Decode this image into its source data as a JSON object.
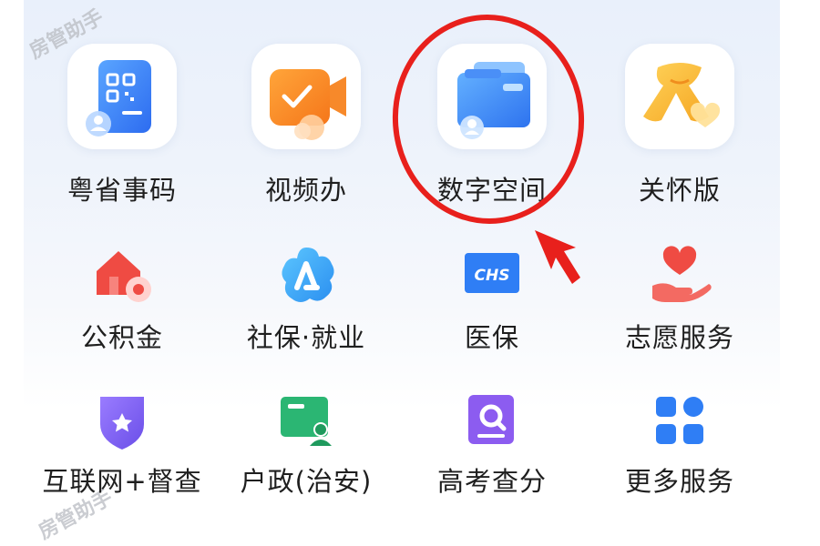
{
  "watermark": "房管助手",
  "colors": {
    "highlight_red": "#e8201c",
    "primary_blue": "#2f7ef5",
    "orange": "#f7891f",
    "yellow": "#f7b733",
    "green": "#2bb673",
    "purple": "#7b5cf0",
    "red_icon": "#ef4b43"
  },
  "services": {
    "row1": [
      {
        "label": "粤省事码",
        "icon": "qr-card-icon"
      },
      {
        "label": "视频办",
        "icon": "video-check-icon"
      },
      {
        "label": "数字空间",
        "icon": "wallet-user-icon",
        "highlighted": true
      },
      {
        "label": "关怀版",
        "icon": "scarf-heart-icon"
      }
    ],
    "row2": [
      {
        "label": "公积金",
        "icon": "house-coin-icon"
      },
      {
        "label": "社保·就业",
        "icon": "social-security-icon"
      },
      {
        "label": "医保",
        "icon": "chs-card-icon"
      },
      {
        "label": "志愿服务",
        "icon": "heart-hand-icon"
      }
    ],
    "row3": [
      {
        "label": "互联网+督查",
        "icon": "shield-star-icon"
      },
      {
        "label": "户政(治安)",
        "icon": "id-card-icon"
      },
      {
        "label": "高考查分",
        "icon": "search-doc-icon"
      },
      {
        "label": "更多服务",
        "icon": "grid-icon"
      }
    ]
  },
  "icon_texts": {
    "chs": "CHS"
  }
}
